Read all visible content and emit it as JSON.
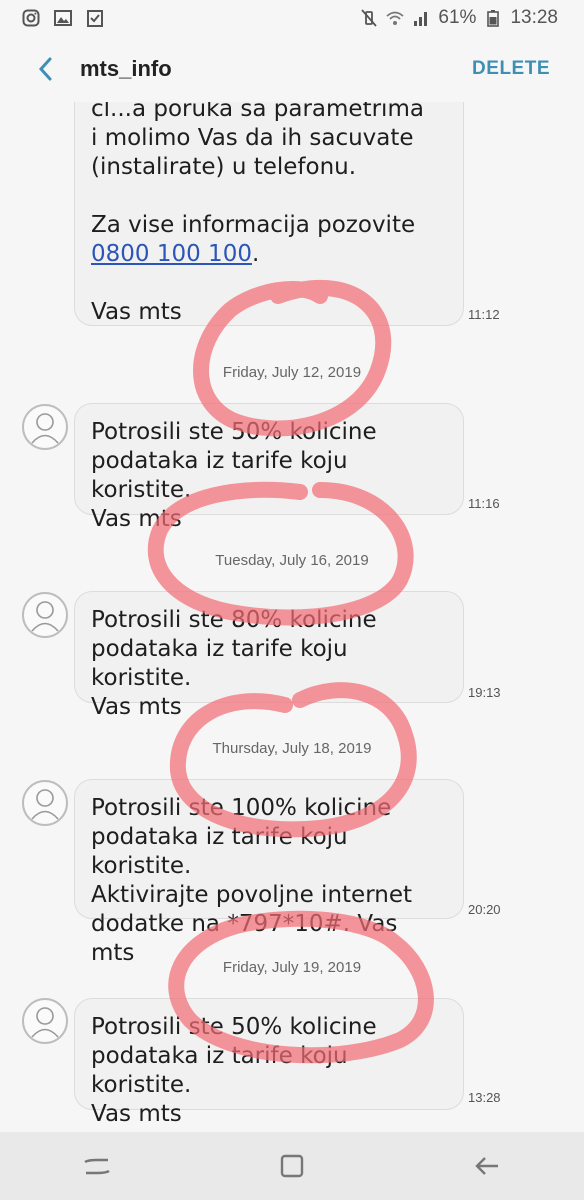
{
  "status_bar": {
    "battery": "61%",
    "time": "13:28",
    "left_icons": [
      "instagram-icon",
      "gallery-icon",
      "checklist-icon"
    ],
    "right_icons": [
      "mute-vibrate-icon",
      "wifi-icon",
      "signal-icon",
      "battery-icon"
    ]
  },
  "header": {
    "title": "mts_info",
    "delete_label": "DELETE"
  },
  "messages": [
    {
      "lines_1": [
        "cl...a poruka sa parametrima",
        "i molimo Vas da ih sacuvate",
        "(instalirate) u telefonu."
      ],
      "lines_2_pre": "Za vise informacija pozovite",
      "phone_link": "0800 100 100",
      "after_link": ".",
      "signature": "Vas mts",
      "time": "11:12"
    },
    {
      "date": "Friday, July 12, 2019",
      "lines": [
        "Potrosili ste 50% kolicine",
        "podataka iz tarife koju koristite.",
        "Vas mts"
      ],
      "time": "11:16"
    },
    {
      "date": "Tuesday, July 16, 2019",
      "lines": [
        "Potrosili ste 80% kolicine",
        "podataka iz tarife koju koristite.",
        "Vas mts"
      ],
      "time": "19:13"
    },
    {
      "date": "Thursday, July 18, 2019",
      "lines": [
        "Potrosili ste 100% kolicine",
        "podataka iz tarife koju koristite.",
        "Aktivirajte povoljne internet",
        "dodatke na *797*10#. Vas mts"
      ],
      "time": "20:20"
    },
    {
      "date": "Friday, July 19, 2019",
      "lines": [
        "Potrosili ste 50% kolicine",
        "podataka iz tarife koju koristite.",
        "Vas mts"
      ],
      "time": "13:28"
    }
  ],
  "colors": {
    "accent": "#3f8fb5",
    "link": "#2c55b8",
    "annotation": "#f26b74"
  },
  "nav": [
    "recent-apps-icon",
    "home-icon",
    "back-icon"
  ]
}
